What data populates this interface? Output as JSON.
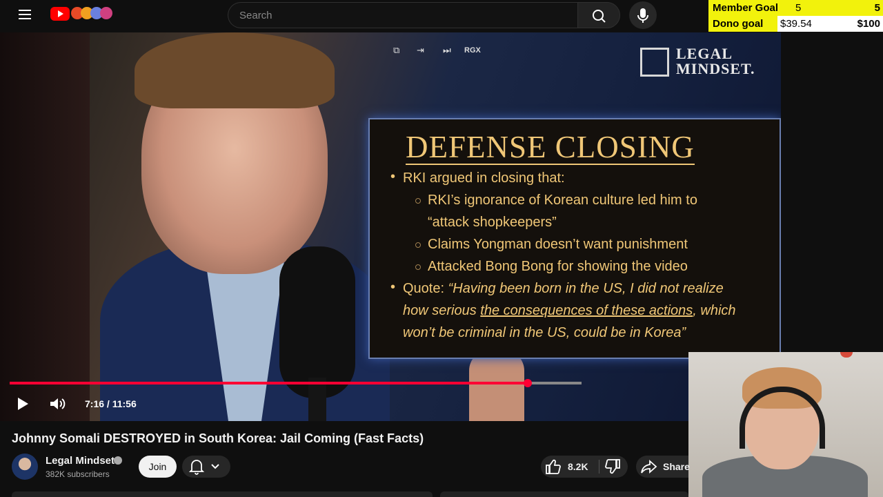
{
  "header": {
    "search_placeholder": "Search",
    "icons": [
      "menu-icon",
      "youtube-logo-icon",
      "extension-icons",
      "search-icon",
      "mic-icon"
    ]
  },
  "goal_overlay": {
    "member_goal": {
      "label": "Member Goal",
      "current": "5",
      "target": "5"
    },
    "dono_goal": {
      "label": "Dono goal",
      "current": "$39.54",
      "target": "$100"
    },
    "colors": {
      "background": "#f2f20c",
      "fill": "#ffffff"
    }
  },
  "video": {
    "watermark_line1": "LEGAL",
    "watermark_line2": "MINDSET.",
    "overlay_label": "RGX",
    "slide": {
      "title": "DEFENSE CLOSING",
      "bullet1": "RKI argued in closing that:",
      "sub1a": "RKI’s ignorance of Korean culture led him to",
      "sub1b": "“attack shopkeepers”",
      "sub2": "Claims Yongman doesn’t want punishment",
      "sub3": "Attacked Bong Bong for showing the video",
      "quote_prefix": "Quote: ",
      "quote1": "“Having been born in the US, I did not realize",
      "quote2a": "how serious ",
      "quote2b": "the consequences of these actions",
      "quote2c": ", which",
      "quote3": "won’t be criminal in the US, could be in Korea”",
      "color": "#f0c777"
    },
    "time_display": "7:16 / 11:56",
    "progress_fraction": 0.906,
    "accent_color": "#ff0033"
  },
  "below": {
    "title": "Johnny Somali DESTROYED in South Korea: Jail Coming (Fast Facts)",
    "channel_name": "Legal Mindset",
    "subscribers": "382K subscribers",
    "join_label": "Join",
    "like_count": "8.2K",
    "share_label": "Share"
  }
}
